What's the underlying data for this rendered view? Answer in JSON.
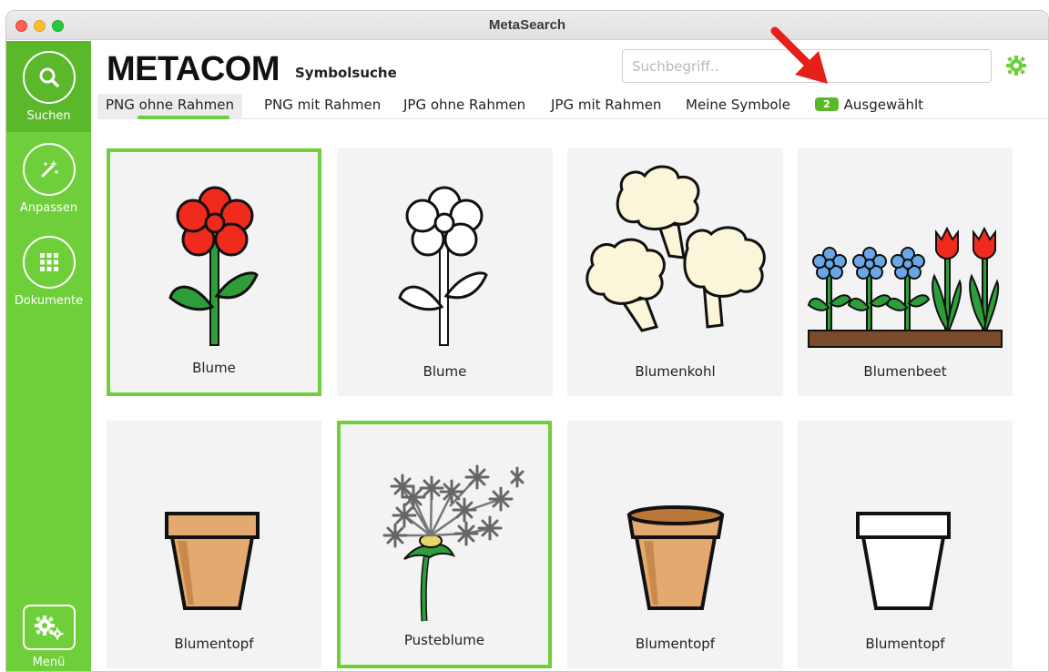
{
  "window": {
    "title": "MetaSearch"
  },
  "sidebar": {
    "items": [
      {
        "label": "Suchen",
        "icon": "search-icon"
      },
      {
        "label": "Anpassen",
        "icon": "magic-wand-icon"
      },
      {
        "label": "Dokumente",
        "icon": "grid-icon"
      }
    ],
    "menu": {
      "label": "Menü",
      "icon": "gears-icon"
    }
  },
  "header": {
    "logo": "METACOM",
    "subtitle": "Symbolsuche",
    "search_placeholder": "Suchbegriff..",
    "search_value": ""
  },
  "tabs": [
    {
      "label": "PNG ohne Rahmen",
      "active": true
    },
    {
      "label": "PNG mit Rahmen",
      "active": false
    },
    {
      "label": "JPG ohne Rahmen",
      "active": false
    },
    {
      "label": "JPG mit Rahmen",
      "active": false
    },
    {
      "label": "Meine Symbole",
      "active": false
    },
    {
      "label": "Ausgewählt",
      "badge": "2",
      "active": false
    }
  ],
  "results": [
    {
      "label": "Blume",
      "icon": "red-flower-icon",
      "selected": true
    },
    {
      "label": "Blume",
      "icon": "outline-flower-icon",
      "selected": false
    },
    {
      "label": "Blumenkohl",
      "icon": "cauliflower-icon",
      "selected": false
    },
    {
      "label": "Blumenbeet",
      "icon": "flowerbed-icon",
      "selected": false
    },
    {
      "label": "Blumentopf",
      "icon": "flowerpot-icon",
      "selected": false
    },
    {
      "label": "Pusteblume",
      "icon": "dandelion-icon",
      "selected": true
    },
    {
      "label": "Blumentopf",
      "icon": "flowerpot-3d-icon",
      "selected": false
    },
    {
      "label": "Blumentopf",
      "icon": "white-flowerpot-icon",
      "selected": false
    }
  ],
  "colors": {
    "accent": "#6fcf3a",
    "accent_dark": "#5bb82a",
    "arrow": "#e5201b",
    "card_bg": "#f3f3f3"
  }
}
